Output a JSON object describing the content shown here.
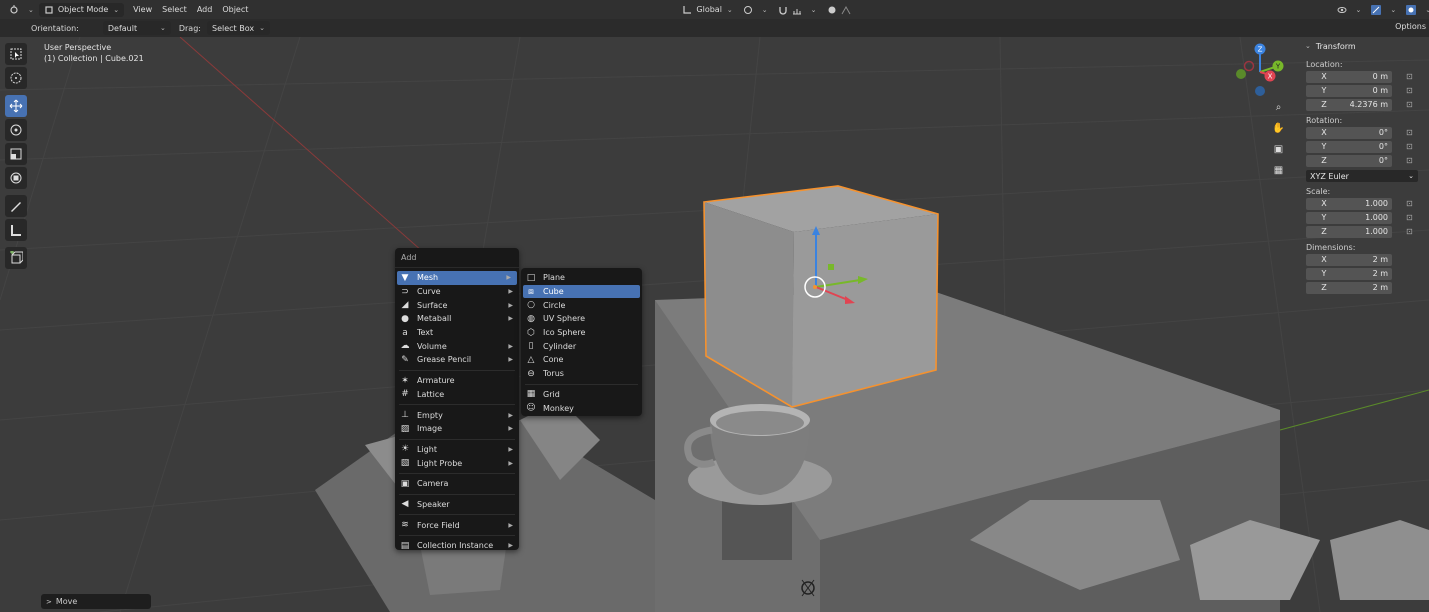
{
  "header": {
    "mode": "Object Mode",
    "menus": [
      "View",
      "Select",
      "Add",
      "Object"
    ],
    "transform_orientation": "Global"
  },
  "toolsettings": {
    "orientation_label": "Orientation:",
    "orientation_value": "Default",
    "drag_label": "Drag:",
    "drag_value": "Select Box"
  },
  "options_label": "Options",
  "viewport_info": {
    "line1": "User Perspective",
    "line2": "(1) Collection | Cube.021"
  },
  "gizmo_axes": {
    "z": "Z",
    "y": "Y",
    "x": "X"
  },
  "transform_panel": {
    "title": "Transform",
    "location_label": "Location:",
    "location": [
      {
        "axis": "X",
        "value": "0 m"
      },
      {
        "axis": "Y",
        "value": "0 m"
      },
      {
        "axis": "Z",
        "value": "4.2376 m"
      }
    ],
    "rotation_label": "Rotation:",
    "rotation": [
      {
        "axis": "X",
        "value": "0°"
      },
      {
        "axis": "Y",
        "value": "0°"
      },
      {
        "axis": "Z",
        "value": "0°"
      }
    ],
    "rotation_mode": "XYZ Euler",
    "scale_label": "Scale:",
    "scale": [
      {
        "axis": "X",
        "value": "1.000"
      },
      {
        "axis": "Y",
        "value": "1.000"
      },
      {
        "axis": "Z",
        "value": "1.000"
      }
    ],
    "dimensions_label": "Dimensions:",
    "dimensions": [
      {
        "axis": "X",
        "value": "2 m"
      },
      {
        "axis": "Y",
        "value": "2 m"
      },
      {
        "axis": "Z",
        "value": "2 m"
      }
    ]
  },
  "add_menu": {
    "title": "Add",
    "items": [
      "Mesh",
      "Curve",
      "Surface",
      "Metaball",
      "Text",
      "Volume",
      "Grease Pencil",
      "Armature",
      "Lattice",
      "Empty",
      "Image",
      "Light",
      "Light Probe",
      "Camera",
      "Speaker",
      "Force Field",
      "Collection Instance"
    ]
  },
  "mesh_menu": {
    "items": [
      "Plane",
      "Cube",
      "Circle",
      "UV Sphere",
      "Ico Sphere",
      "Cylinder",
      "Cone",
      "Torus",
      "Grid",
      "Monkey"
    ]
  },
  "last_operator": "Move",
  "colors": {
    "accent": "#4772b3",
    "selection_outline": "#f5922f",
    "axis_x": "#e14452",
    "axis_y": "#78b82a",
    "axis_z": "#3b83e0"
  }
}
